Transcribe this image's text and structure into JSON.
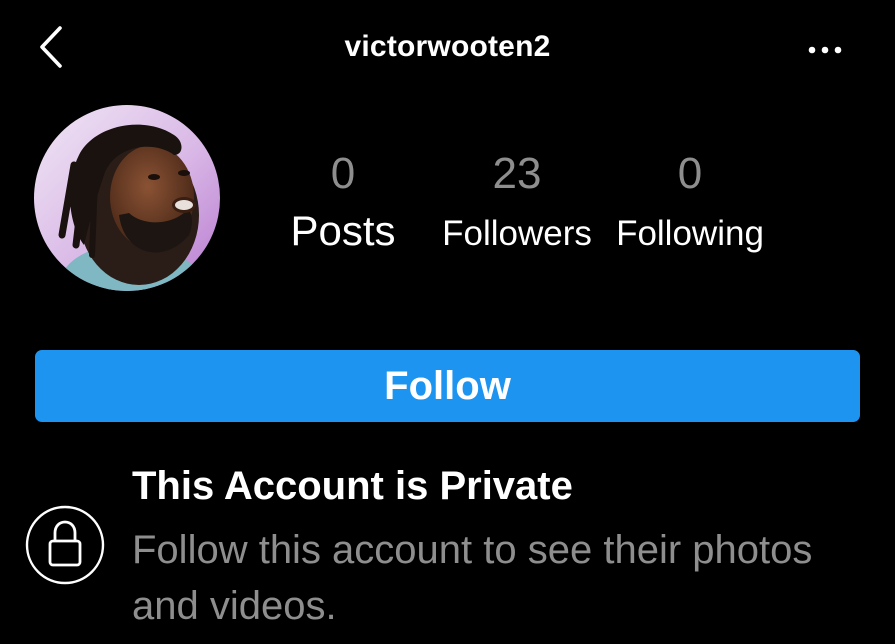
{
  "header": {
    "username": "victorwooten2",
    "back_icon": "chevron-left-icon",
    "more_icon": "more-horizontal-icon"
  },
  "profile": {
    "avatar_icon": "profile-photo",
    "stats": [
      {
        "count": "0",
        "label": "Posts"
      },
      {
        "count": "23",
        "label": "Followers"
      },
      {
        "count": "0",
        "label": "Following"
      }
    ]
  },
  "actions": {
    "follow_label": "Follow"
  },
  "private_notice": {
    "icon": "lock-icon",
    "title": "This Account is Private",
    "description": "Follow this account to see their photos and videos."
  },
  "colors": {
    "background": "#000000",
    "primary_button": "#1d95f0",
    "muted_text": "#8e8e8e",
    "text": "#ffffff"
  }
}
